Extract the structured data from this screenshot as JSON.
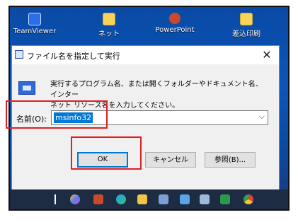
{
  "desktop": {
    "icons": [
      {
        "label": "TeamViewer"
      },
      {
        "label": "ネット"
      },
      {
        "label": "PowerPoint"
      },
      {
        "label": "差込印刷"
      }
    ]
  },
  "dialog": {
    "title": "ファイル名を指定して実行",
    "close_glyph": "✕",
    "description_line1": "実行するプログラム名、または開くフォルダーやドキュメント名、インター",
    "description_line2": "ネット リソース名を入力してください。",
    "name_label": "名前(O):",
    "name_value": "msinfo32",
    "dropdown_glyph": "⌵",
    "buttons": {
      "ok": "OK",
      "cancel": "キャンセル",
      "browse": "参照(B)..."
    }
  },
  "taskbar": {
    "icons": [
      "task-view-icon",
      "copilot-icon",
      "powerpoint-icon",
      "edge-icon",
      "explorer-icon",
      "store-icon",
      "photos-icon",
      "app-icon",
      "excel-icon",
      "chrome-icon"
    ]
  },
  "annotations": {
    "highlight_color": "#e01f1f"
  }
}
